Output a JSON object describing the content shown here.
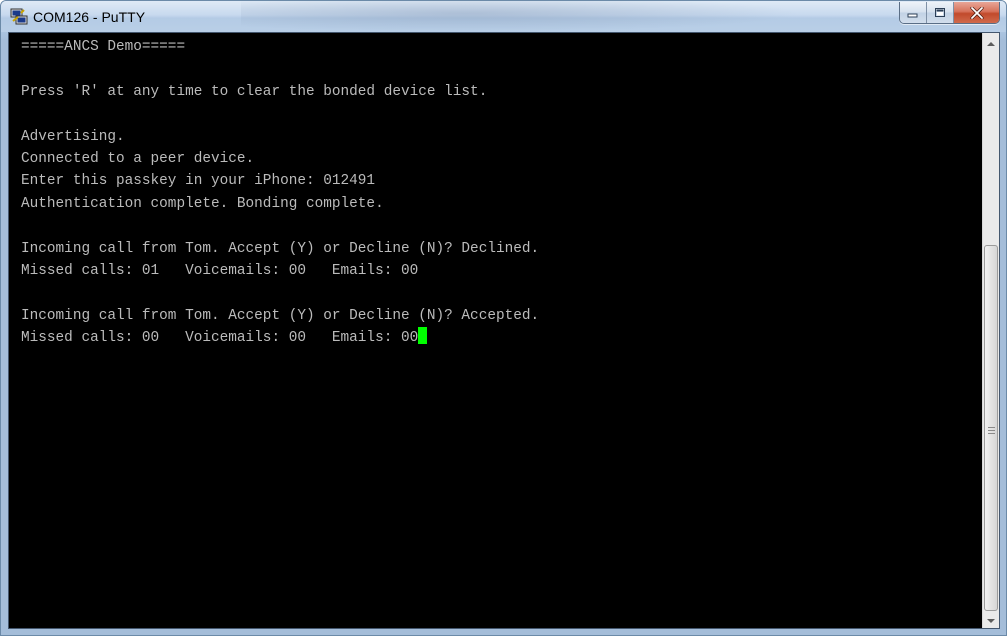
{
  "window": {
    "title": "COM126 - PuTTY",
    "icon": "putty-icon"
  },
  "controls": {
    "minimize_icon": "minimize-icon",
    "maximize_icon": "maximize-icon",
    "close_icon": "close-icon"
  },
  "terminal": {
    "lines": [
      "=====ANCS Demo=====",
      "",
      "Press 'R' at any time to clear the bonded device list.",
      "",
      "Advertising.",
      "Connected to a peer device.",
      "Enter this passkey in your iPhone: 012491",
      "Authentication complete. Bonding complete.",
      "",
      "Incoming call from Tom. Accept (Y) or Decline (N)? Declined.",
      "Missed calls: 01   Voicemails: 00   Emails: 00",
      "",
      "Incoming call from Tom. Accept (Y) or Decline (N)? Accepted.",
      "Missed calls: 00   Voicemails: 00   Emails: 00"
    ],
    "colors": {
      "background": "#000000",
      "foreground": "#bbbbbb",
      "cursor": "#00ff00"
    }
  },
  "scrollbar": {
    "up_icon": "scroll-up-arrow-icon",
    "down_icon": "scroll-down-arrow-icon"
  }
}
